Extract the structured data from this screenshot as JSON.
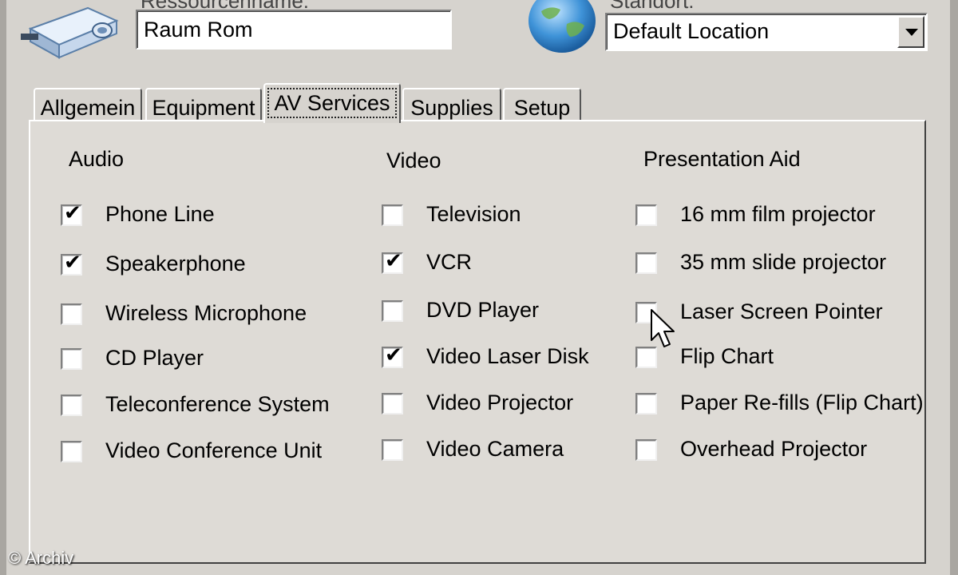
{
  "header": {
    "resource_label": "Ressourcenname:",
    "resource_value": "Raum Rom",
    "location_label": "Standort:",
    "location_value": "Default Location"
  },
  "tabs": [
    {
      "label": "Allgemein",
      "active": false
    },
    {
      "label": "Equipment",
      "active": false
    },
    {
      "label": "AV Services",
      "active": true
    },
    {
      "label": "Supplies",
      "active": false
    },
    {
      "label": "Setup",
      "active": false
    }
  ],
  "groups": {
    "audio": {
      "heading": "Audio",
      "items": [
        {
          "label": "Phone Line",
          "checked": true
        },
        {
          "label": "Speakerphone",
          "checked": true
        },
        {
          "label": "Wireless Microphone",
          "checked": false
        },
        {
          "label": "CD Player",
          "checked": false
        },
        {
          "label": "Teleconference System",
          "checked": false
        },
        {
          "label": "Video Conference Unit",
          "checked": false
        }
      ]
    },
    "video": {
      "heading": "Video",
      "items": [
        {
          "label": "Television",
          "checked": false
        },
        {
          "label": "VCR",
          "checked": true
        },
        {
          "label": "DVD Player",
          "checked": false
        },
        {
          "label": "Video Laser Disk",
          "checked": true
        },
        {
          "label": "Video Projector",
          "checked": false
        },
        {
          "label": "Video Camera",
          "checked": false
        }
      ]
    },
    "presentation": {
      "heading": "Presentation Aid",
      "items": [
        {
          "label": "16 mm film projector",
          "checked": false
        },
        {
          "label": "35 mm slide projector",
          "checked": false
        },
        {
          "label": "Laser Screen Pointer",
          "checked": false
        },
        {
          "label": "Flip Chart",
          "checked": false
        },
        {
          "label": "Paper Re-fills (Flip Chart)",
          "checked": false
        },
        {
          "label": "Overhead Projector",
          "checked": false
        }
      ]
    }
  },
  "checkmark_glyph": "✔",
  "watermark": "© Archiv",
  "icons": {
    "resource": "projector-icon",
    "location": "globe-icon",
    "cursor": "mouse-pointer-icon"
  }
}
